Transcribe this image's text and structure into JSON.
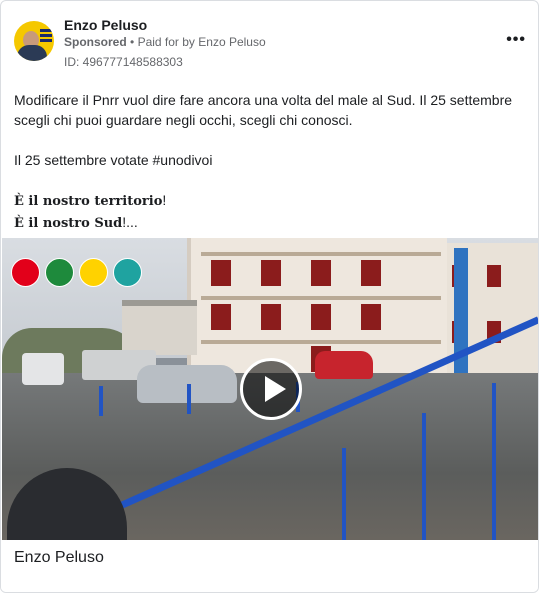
{
  "post": {
    "author": "Enzo Peluso",
    "sponsored_label": "Sponsored",
    "separator": "•",
    "paid_by": "Paid for by Enzo Peluso",
    "ad_id": "ID: 496777148588303",
    "more_label": "•••"
  },
  "body": {
    "paragraph1": "Modificare il Pnrr vuol dire fare ancora una volta del male al Sud. Il 25 settembre scegli chi puoi guardare negli occhi, scegli chi conosci.",
    "paragraph2": "Il 25 settembre votate #unodivoi",
    "line3_bold": "È il nostro territorio",
    "line3_tail": "!",
    "line4_bold": "È il nostro Sud",
    "line4_tail": "!..."
  },
  "video": {
    "play_icon": "play-icon",
    "logos": [
      "pd-logo",
      "ssi-logo",
      "europa-logo",
      "di-maio-logo"
    ],
    "colors": {
      "pd": "#e2001a",
      "ssi": "#1e8a3c",
      "europa": "#ffd200",
      "di_maio": "#1fa3a0"
    }
  },
  "footer": {
    "link_name": "Enzo Peluso"
  },
  "colors": {
    "text_primary": "#1c1e21",
    "text_secondary": "#65676b",
    "border": "#dadde1"
  }
}
